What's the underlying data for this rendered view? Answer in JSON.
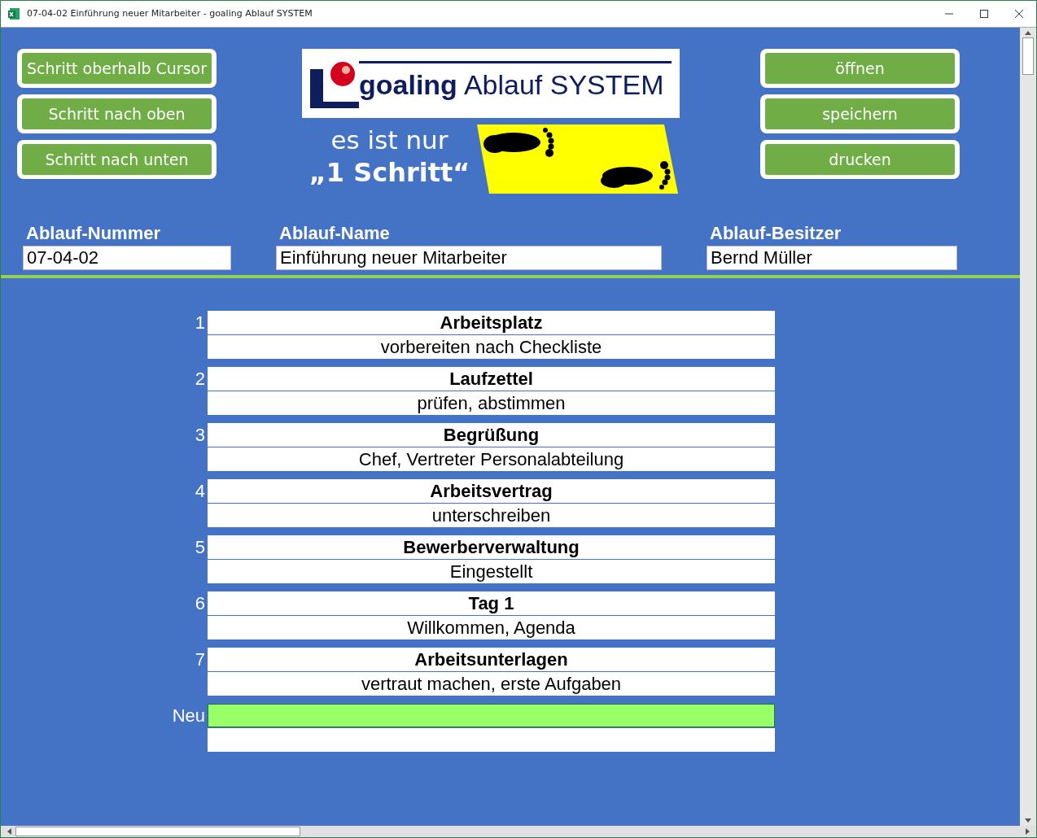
{
  "window": {
    "title": "07-04-02 Einführung neuer Mitarbeiter - goaling Ablauf SYSTEM"
  },
  "left_buttons": [
    "Schritt oberhalb Cursor",
    "Schritt nach oben",
    "Schritt nach unten"
  ],
  "logo": {
    "brand": "goaling",
    "product": "Ablauf SYSTEM"
  },
  "tagline": [
    "es ist nur",
    "„1 Schritt“"
  ],
  "right_buttons": [
    "öffnen",
    "speichern",
    "drucken"
  ],
  "fields": [
    {
      "label": "Ablauf-Nummer",
      "value": "07-04-02"
    },
    {
      "label": "Ablauf-Name",
      "value": "Einführung neuer Mitarbeiter"
    },
    {
      "label": "Ablauf-Besitzer",
      "value": "Bernd Müller"
    }
  ],
  "steps": [
    {
      "number": "1",
      "title": "Arbeitsplatz",
      "description": "vorbereiten nach Checkliste",
      "selected": false
    },
    {
      "number": "2",
      "title": "Laufzettel",
      "description": "prüfen, abstimmen",
      "selected": false
    },
    {
      "number": "3",
      "title": "Begrüßung",
      "description": "Chef, Vertreter Personalabteilung",
      "selected": false
    },
    {
      "number": "4",
      "title": "Arbeitsvertrag",
      "description": "unterschreiben",
      "selected": false
    },
    {
      "number": "5",
      "title": "Bewerberverwaltung",
      "description": "Eingestellt",
      "selected": false
    },
    {
      "number": "6",
      "title": "Tag 1",
      "description": "Willkommen, Agenda",
      "selected": false
    },
    {
      "number": "7",
      "title": "Arbeitsunterlagen",
      "description": "vertraut machen, erste Aufgaben",
      "selected": false
    },
    {
      "number": "Neu",
      "selected": true
    }
  ]
}
